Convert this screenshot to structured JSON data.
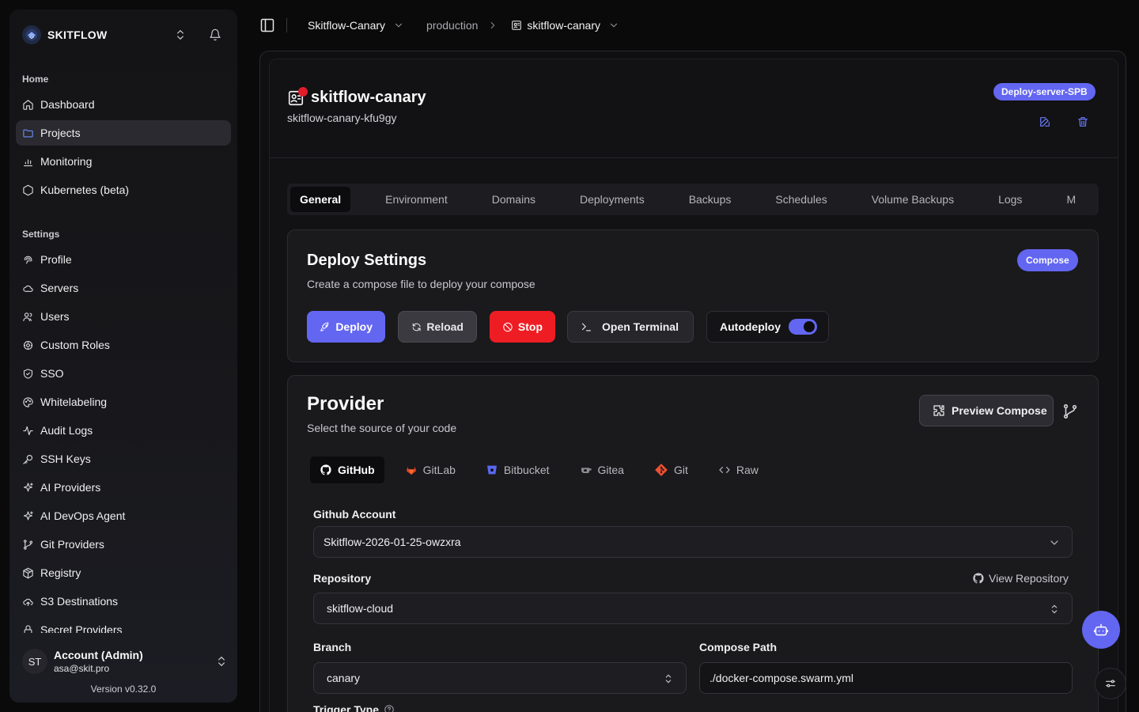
{
  "brand": {
    "name": "SKITFLOW"
  },
  "sidebar": {
    "home_label": "Home",
    "home_items": [
      {
        "label": "Dashboard",
        "icon": "home-icon"
      },
      {
        "label": "Projects",
        "icon": "folder-icon",
        "active": true
      },
      {
        "label": "Monitoring",
        "icon": "bar-chart-icon"
      },
      {
        "label": "Kubernetes (beta)",
        "icon": "hexagon-icon"
      }
    ],
    "settings_label": "Settings",
    "settings_items": [
      {
        "label": "Profile",
        "icon": "fingerprint-icon"
      },
      {
        "label": "Servers",
        "icon": "cloud-icon"
      },
      {
        "label": "Users",
        "icon": "users-icon"
      },
      {
        "label": "Custom Roles",
        "icon": "user-cog-icon"
      },
      {
        "label": "SSO",
        "icon": "shield-check-icon"
      },
      {
        "label": "Whitelabeling",
        "icon": "palette-icon"
      },
      {
        "label": "Audit Logs",
        "icon": "activity-icon"
      },
      {
        "label": "SSH Keys",
        "icon": "key-icon"
      },
      {
        "label": "AI Providers",
        "icon": "sparkles-icon"
      },
      {
        "label": "AI DevOps Agent",
        "icon": "sparkles-icon"
      },
      {
        "label": "Git Providers",
        "icon": "git-branch-icon"
      },
      {
        "label": "Registry",
        "icon": "package-icon"
      },
      {
        "label": "S3 Destinations",
        "icon": "cloud-upload-icon"
      },
      {
        "label": "Secret Providers",
        "icon": "lock-icon"
      }
    ],
    "account": {
      "initials": "ST",
      "name": "Account (Admin)",
      "email": "asa@skit.pro"
    },
    "version": "Version v0.32.0"
  },
  "breadcrumb": {
    "project": "Skitflow-Canary",
    "environment": "production",
    "service": "skitflow-canary"
  },
  "service": {
    "title": "skitflow-canary",
    "app_name": "skitflow-canary-kfu9gy",
    "server_badge": "Deploy-server-SPB",
    "status_color": "#e11d2a"
  },
  "tabs": [
    "General",
    "Environment",
    "Domains",
    "Deployments",
    "Backups",
    "Schedules",
    "Volume Backups",
    "Logs",
    "M"
  ],
  "deploy_settings": {
    "title": "Deploy Settings",
    "description": "Create a compose file to deploy your compose",
    "badge": "Compose",
    "buttons": {
      "deploy": "Deploy",
      "reload": "Reload",
      "stop": "Stop",
      "terminal": "Open Terminal"
    },
    "autodeploy_label": "Autodeploy",
    "autodeploy_enabled": true
  },
  "provider": {
    "title": "Provider",
    "description": "Select the source of your code",
    "preview_button": "Preview Compose",
    "tabs": [
      "GitHub",
      "GitLab",
      "Bitbucket",
      "Gitea",
      "Git",
      "Raw"
    ],
    "account_label": "Github Account",
    "account_value": "Skitflow-2026-01-25-owzxra",
    "repository_label": "Repository",
    "view_repository": "View Repository",
    "repository_value": "skitflow-cloud",
    "branch_label": "Branch",
    "branch_value": "canary",
    "compose_path_label": "Compose Path",
    "compose_path_value": "./docker-compose.swarm.yml",
    "trigger_label": "Trigger Type"
  },
  "colors": {
    "accent": "#6366f1",
    "danger": "#ee1d23"
  }
}
